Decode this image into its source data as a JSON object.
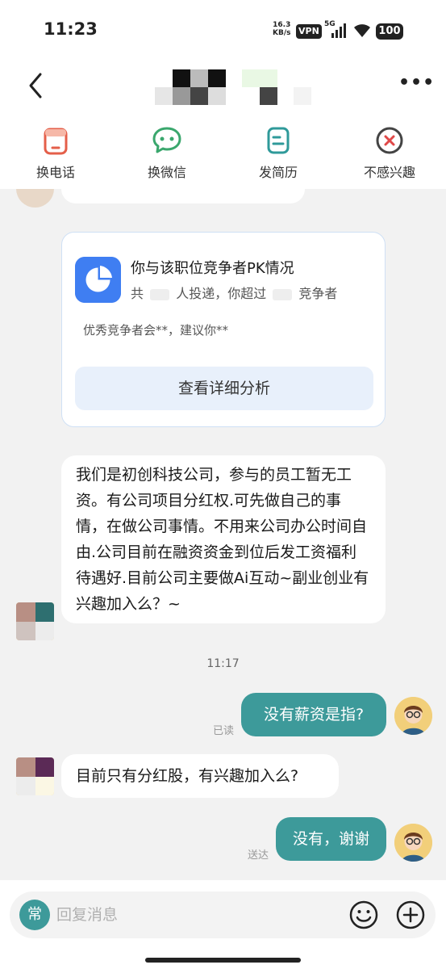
{
  "status_bar": {
    "time": "11:23",
    "speed_value": "16.3",
    "speed_unit": "KB/s",
    "vpn": "VPN",
    "network": "5G",
    "battery": "100"
  },
  "header": {
    "contact_name": "",
    "more_icon": "more-dots-icon"
  },
  "actions": [
    {
      "label": "换电话",
      "icon": "phone-card-icon"
    },
    {
      "label": "换微信",
      "icon": "wechat-icon"
    },
    {
      "label": "发简历",
      "icon": "resume-icon"
    },
    {
      "label": "不感兴趣",
      "icon": "close-circle-icon"
    }
  ],
  "pk_card": {
    "title": "你与该职位竞争者PK情况",
    "sub_prefix": "共",
    "sub_middle": "人投递，你超过",
    "sub_suffix": "竞争者",
    "hint": "优秀竞争者会**，建议你**",
    "button": "查看详细分析"
  },
  "messages": {
    "incoming_1": "我们是初创科技公司，参与的员工暂无工资。有公司项目分红权.可先做自己的事情，在做公司事情。不用来公司办公时间自由.公司目前在融资资金到位后发工资福利待遇好.目前公司主要做Ai互动~副业创业有兴趣加入么？~",
    "timestamp": "11:17",
    "outgoing_1": "没有薪资是指?",
    "outgoing_1_status": "已读",
    "incoming_2": "目前只有分红股，有兴趣加入么?",
    "outgoing_2": "没有，谢谢",
    "outgoing_2_status": "送达"
  },
  "input": {
    "quick_label": "常",
    "placeholder": "回复消息"
  },
  "colors": {
    "accent": "#3d9a9a",
    "card_blue": "#3f7ef2",
    "background": "#f2f2f2"
  }
}
